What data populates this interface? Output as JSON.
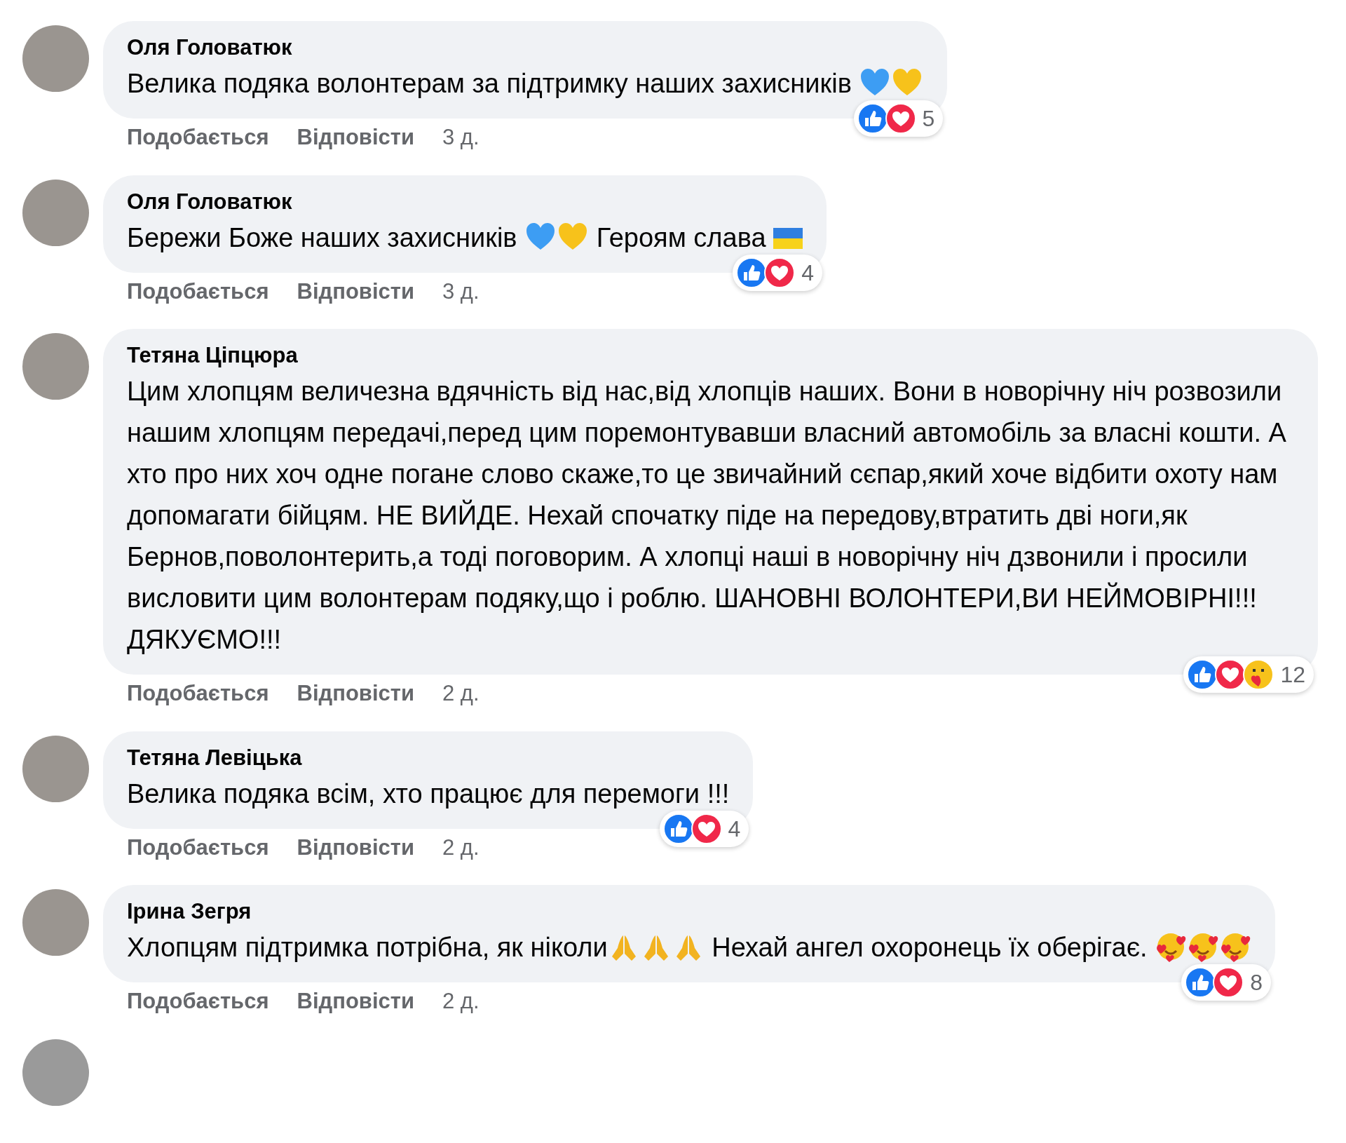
{
  "comments": [
    {
      "author": "Оля Головатюк",
      "body": [
        {
          "kind": "text",
          "text": "Велика подяка волонтерам за підтримку наших захисників "
        },
        {
          "kind": "heart",
          "color": "#3d9df3"
        },
        {
          "kind": "heart",
          "color": "#f7c21b"
        }
      ],
      "reactions": [
        {
          "kind": "like"
        },
        {
          "kind": "love"
        }
      ],
      "reaction_count": "5",
      "actions": [
        "Подобається",
        "Відповісти"
      ],
      "time": "3 д."
    },
    {
      "author": "Оля Головатюк",
      "body": [
        {
          "kind": "text",
          "text": "Бережи Боже наших захисників "
        },
        {
          "kind": "heart",
          "color": "#3d9df3"
        },
        {
          "kind": "heart",
          "color": "#f7c21b"
        },
        {
          "kind": "text",
          "text": " Героям слава "
        },
        {
          "kind": "flag"
        }
      ],
      "reactions": [
        {
          "kind": "like"
        },
        {
          "kind": "love"
        }
      ],
      "reaction_count": "4",
      "actions": [
        "Подобається",
        "Відповісти"
      ],
      "time": "3 д."
    },
    {
      "author": "Тетяна Ціпцюра",
      "body": [
        {
          "kind": "text",
          "text": "Цим хлопцям величезна вдячність від нас,від хлопців наших. Вони в новорічну ніч розвозили нашим хлопцям передачі,перед цим поремонтувавши власний автомобіль за власні кошти. А хто про них хоч одне погане слово скаже,то це звичайний сєпар,який хоче відбити охоту нам допомагати бійцям. НЕ ВИЙДЕ. Нехай спочатку піде на передову,втратить дві ноги,як Бернов,поволонтерить,а тоді поговорим. А хлопці наші в новорічну ніч дзвонили і просили висловити цим волонтерам подяку,що і роблю. ШАНОВНІ ВОЛОНТЕРИ,ВИ НЕЙМОВІРНІ!!! ДЯКУЄМО!!!"
        }
      ],
      "reactions": [
        {
          "kind": "like"
        },
        {
          "kind": "love"
        },
        {
          "kind": "care"
        }
      ],
      "reaction_count": "12",
      "actions": [
        "Подобається",
        "Відповісти"
      ],
      "time": "2 д."
    },
    {
      "author": "Тетяна Левіцька",
      "body": [
        {
          "kind": "text",
          "text": "Велика подяка всім, хто працює для перемоги !!!"
        }
      ],
      "reactions": [
        {
          "kind": "like"
        },
        {
          "kind": "love"
        }
      ],
      "reaction_count": "4",
      "actions": [
        "Подобається",
        "Відповісти"
      ],
      "time": "2 д."
    },
    {
      "author": "Ірина Зегря",
      "body": [
        {
          "kind": "text",
          "text": "Хлопцям підтримка потрібна, як ніколи"
        },
        {
          "kind": "pray"
        },
        {
          "kind": "pray"
        },
        {
          "kind": "pray"
        },
        {
          "kind": "text",
          "text": " Нехай ангел охоронець їх оберігає. "
        },
        {
          "kind": "hearts-face"
        },
        {
          "kind": "hearts-face"
        },
        {
          "kind": "hearts-face"
        }
      ],
      "reactions": [
        {
          "kind": "like"
        },
        {
          "kind": "love"
        }
      ],
      "reaction_count": "8",
      "actions": [
        "Подобається",
        "Відповісти"
      ],
      "time": "2 д."
    }
  ]
}
